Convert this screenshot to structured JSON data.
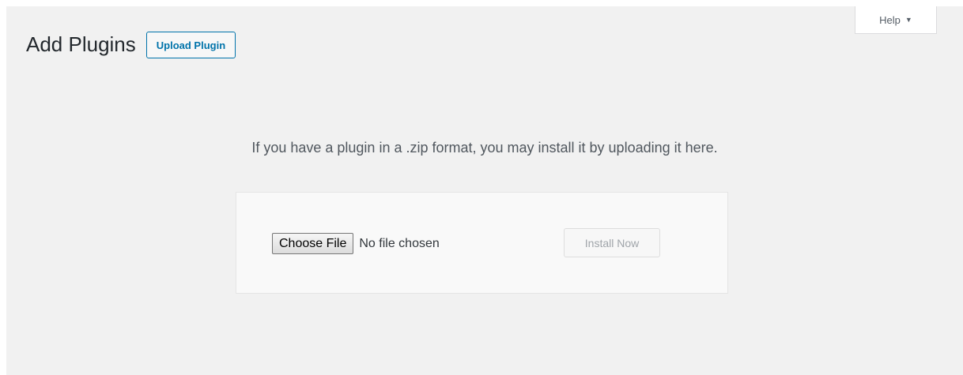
{
  "help_tab": {
    "label": "Help",
    "caret_icon": "caret-down-icon"
  },
  "header": {
    "title": "Add Plugins",
    "upload_button_label": "Upload Plugin"
  },
  "upload_form": {
    "instructions": "If you have a plugin in a .zip format, you may install it by uploading it here.",
    "choose_file_label": "Choose File",
    "file_status": "No file chosen",
    "install_button_label": "Install Now",
    "install_button_disabled": true
  },
  "colors": {
    "background": "#f1f1f1",
    "accent": "#0073aa",
    "title_text": "#23282d",
    "disabled_text": "#a0a5aa"
  }
}
